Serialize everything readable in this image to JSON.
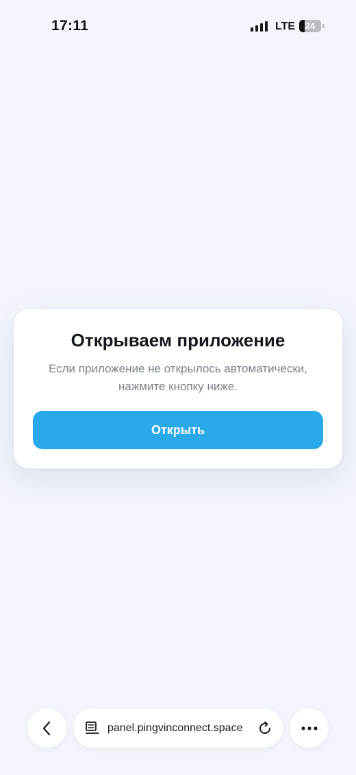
{
  "status_bar": {
    "time": "17:11",
    "network": "LTE",
    "battery": "24",
    "battery_level": 0.24,
    "signal_bars": 4
  },
  "card": {
    "title": "Открываем приложение",
    "subtitle": "Если приложение не открылось автоматически, нажмите кнопку ниже.",
    "button_label": "Открыть",
    "button_color": "#2aa9ea"
  },
  "browser_bar": {
    "url": "panel.pingvinconnect.space",
    "back_icon": "chevron-left-icon",
    "page_icon": "page-menu-icon",
    "reload_icon": "reload-icon",
    "more_icon": "more-horizontal-icon"
  },
  "colors": {
    "background": "#f2f5fb",
    "accent": "#2aa9ea"
  }
}
